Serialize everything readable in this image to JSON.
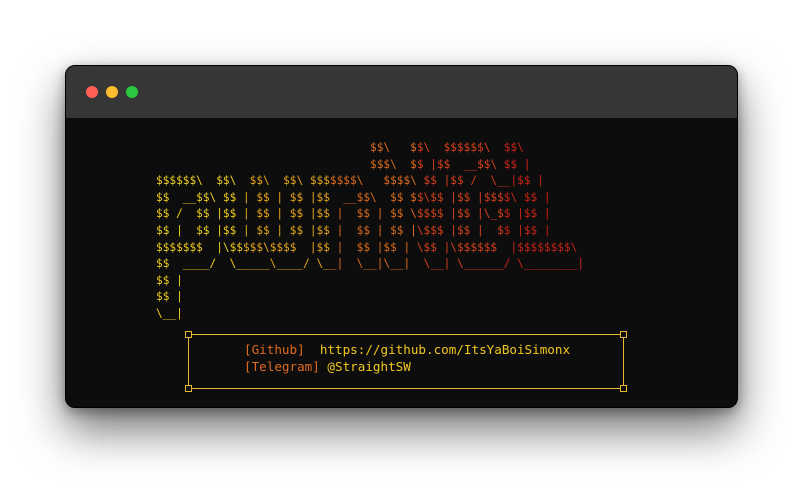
{
  "window": {
    "controls": [
      {
        "name": "close",
        "color": "#ff5f57"
      },
      {
        "name": "minimize",
        "color": "#febc2e"
      },
      {
        "name": "maximize",
        "color": "#28c840"
      }
    ]
  },
  "terminal": {
    "ascii_art_lines": [
      "                                $$\\   $$\\  $$$$$$\\  $$\\",
      "                                $$$\\  $$ |$$  __$$\\ $$ |",
      "$$$$$$\\  $$\\  $$\\  $$\\ $$$$$$$\\   $$$$\\ $$ |$$ /  \\__|$$ |",
      "$$  __$$\\ $$ | $$ | $$ |$$  __$$\\  $$ $$\\$$ |$$ |$$$$\\ $$ |",
      "$$ /  $$ |$$ | $$ | $$ |$$ |  $$ | $$ \\$$$$ |$$ |\\_$$ |$$ |",
      "$$ |  $$ |$$ | $$ | $$ |$$ |  $$ | $$ |\\$$$ |$$ |  $$ |$$ |",
      "$$$$$$$  |\\$$$$$\\$$$$  |$$ |  $$ |$$ | \\$$ |\\$$$$$$  |$$$$$$$$\\",
      "$$  ____/  \\_____\\____/ \\__|  \\__|\\__|  \\__| \\______/ \\________|",
      "$$ |",
      "$$ |",
      "\\__|"
    ],
    "colors": [
      "#f0d020",
      "#e8a818",
      "#e06c1c",
      "#d8401c",
      "#cc2418"
    ],
    "info": {
      "github_label": "[Github]",
      "github_value": "https://github.com/ItsYaBoiSimonx",
      "telegram_label": "[Telegram]",
      "telegram_value": "@StraightSW"
    }
  }
}
